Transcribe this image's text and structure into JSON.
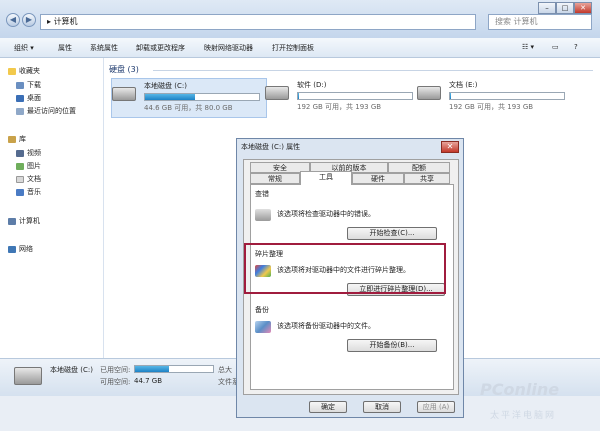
{
  "titlebar": {
    "breadcrumb_root": "▸",
    "breadcrumb": "计算机",
    "search_placeholder": "搜索 计算机"
  },
  "toolbar": {
    "organize": "组织 ▾",
    "properties": "属性",
    "system_properties": "系统属性",
    "uninstall": "卸载或更改程序",
    "map_drive": "映射网络驱动器",
    "control_panel": "打开控制面板"
  },
  "sidebar": {
    "favorites": "收藏夹",
    "downloads": "下载",
    "desktop": "桌面",
    "recent": "最近访问的位置",
    "library": "库",
    "videos": "视频",
    "pictures": "图片",
    "documents": "文档",
    "music": "音乐",
    "computer": "计算机",
    "network": "网络"
  },
  "main": {
    "section_title": "硬盘 (3)",
    "drives": [
      {
        "name": "本地磁盘 (C:)",
        "info": "44.6 GB 可用，共 80.0 GB",
        "used_fraction": 0.44
      },
      {
        "name": "软件 (D:)",
        "info": "192 GB 可用，共 193 GB",
        "used_fraction": 0.01
      },
      {
        "name": "文档 (E:)",
        "info": "192 GB 可用，共 193 GB",
        "used_fraction": 0.01
      }
    ]
  },
  "statusbar": {
    "drive_name": "本地磁盘 (C:)",
    "used_label": "已用空间:",
    "free_label": "可用空间:",
    "free_value": "44.7 GB",
    "total_label": "总大",
    "fs_label": "文件系"
  },
  "dialog": {
    "title": "本地磁盘 (C:) 属性",
    "close": "✕",
    "tabs_row1": [
      "安全",
      "以前的版本",
      "配额"
    ],
    "tabs_row2": [
      "常规",
      "工具",
      "硬件",
      "共享"
    ],
    "check": {
      "title": "查错",
      "text": "该选项将检查驱动器中的错误。",
      "button": "开始检查(C)..."
    },
    "defrag": {
      "title": "碎片整理",
      "text": "该选项将对驱动器中的文件进行碎片整理。",
      "button": "立即进行碎片整理(D)..."
    },
    "backup": {
      "title": "备份",
      "text": "该选项将备份驱动器中的文件。",
      "button": "开始备份(B)..."
    },
    "ok": "确定",
    "cancel": "取消",
    "apply": "应用 (A)"
  },
  "watermark": {
    "brand": "PConline",
    "sub": "太平洋电脑网"
  },
  "colors": {
    "accent_blue": "#1d82c6",
    "highlight_red": "#a01c3e"
  }
}
